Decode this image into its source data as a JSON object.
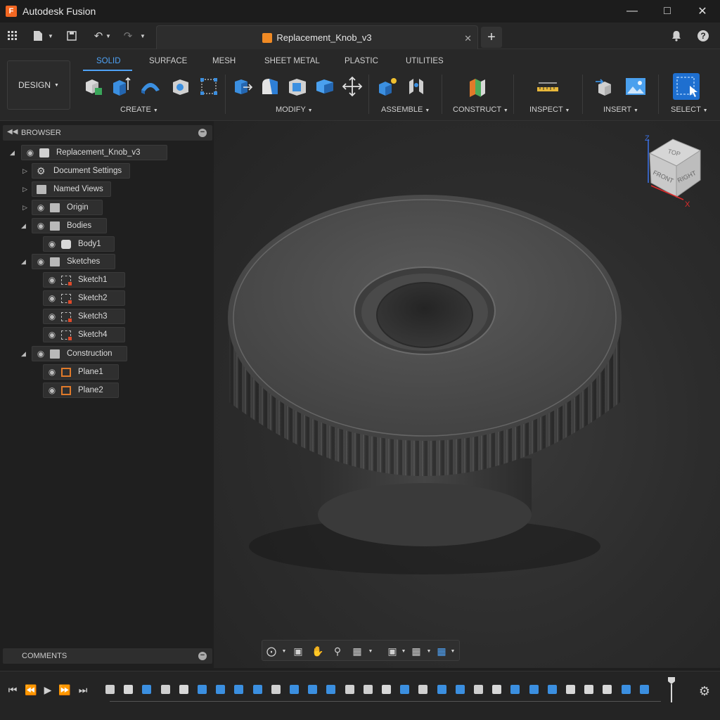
{
  "window": {
    "app_title": "Autodesk Fusion",
    "logo_letter": "F"
  },
  "tabs": {
    "document": "Replacement_Knob_v3"
  },
  "workspace": {
    "label": "DESIGN"
  },
  "ribbon": {
    "tabs": [
      "SOLID",
      "SURFACE",
      "MESH",
      "SHEET METAL",
      "PLASTIC",
      "UTILITIES"
    ],
    "active_tab": "SOLID",
    "groups": [
      "CREATE",
      "MODIFY",
      "ASSEMBLE",
      "CONSTRUCT",
      "INSPECT",
      "INSERT",
      "SELECT"
    ]
  },
  "browser": {
    "title": "BROWSER",
    "root": "Replacement_Knob_v3",
    "items": [
      {
        "label": "Document Settings",
        "icon": "gear-icon"
      },
      {
        "label": "Named Views",
        "icon": "folder-icon"
      },
      {
        "label": "Origin",
        "icon": "folder-icon"
      },
      {
        "label": "Bodies",
        "icon": "folder-icon"
      },
      {
        "label": "Body1",
        "icon": "body-icon"
      },
      {
        "label": "Sketches",
        "icon": "folder-icon"
      },
      {
        "label": "Sketch1",
        "icon": "sketch-icon"
      },
      {
        "label": "Sketch2",
        "icon": "sketch-icon"
      },
      {
        "label": "Sketch3",
        "icon": "sketch-icon"
      },
      {
        "label": "Sketch4",
        "icon": "sketch-icon"
      },
      {
        "label": "Construction",
        "icon": "folder-icon"
      },
      {
        "label": "Plane1",
        "icon": "plane-icon"
      },
      {
        "label": "Plane2",
        "icon": "plane-icon"
      }
    ]
  },
  "viewcube": {
    "top": "TOP",
    "front": "FRONT",
    "right": "RIGHT",
    "axis_z": "Z",
    "axis_x": "X"
  },
  "comments": {
    "title": "COMMENTS"
  },
  "colors": {
    "accent": "#4fa3f7",
    "brand": "#f26722",
    "body": "#4a4a4a"
  }
}
